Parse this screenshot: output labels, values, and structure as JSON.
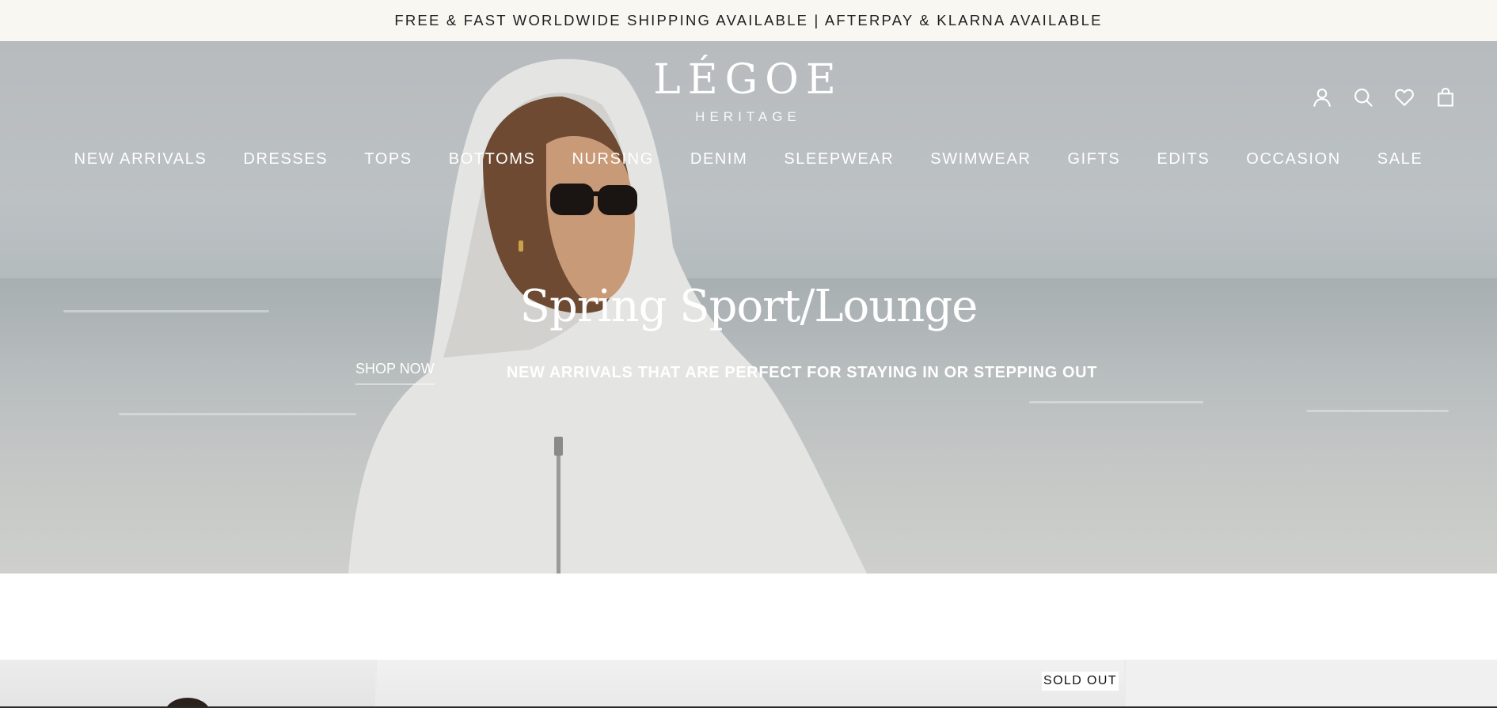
{
  "announcement": {
    "text": "FREE & FAST WORLDWIDE SHIPPING AVAILABLE | AFTERPAY & KLARNA AVAILABLE"
  },
  "brand": {
    "name": "LÉGOE",
    "sub": "HERITAGE"
  },
  "header_icons": [
    "account-icon",
    "search-icon",
    "wishlist-heart-icon",
    "cart-bag-icon"
  ],
  "nav": {
    "items": [
      "NEW ARRIVALS",
      "DRESSES",
      "TOPS",
      "BOTTOMS",
      "NURSING",
      "DENIM",
      "SLEEPWEAR",
      "SWIMWEAR",
      "GIFTS",
      "EDITS",
      "OCCASION",
      "SALE"
    ]
  },
  "hero": {
    "title": "Spring Sport/Lounge",
    "subtitle": "NEW ARRIVALS THAT ARE PERFECT FOR STAYING IN OR STEPPING OUT",
    "cta": "SHOP NOW"
  },
  "products": {
    "badge": "SOLD OUT"
  },
  "colors": {
    "announcement_bg": "#f8f7f2",
    "text_light": "#ffffff",
    "hero_sky": "#b7bbbe"
  }
}
